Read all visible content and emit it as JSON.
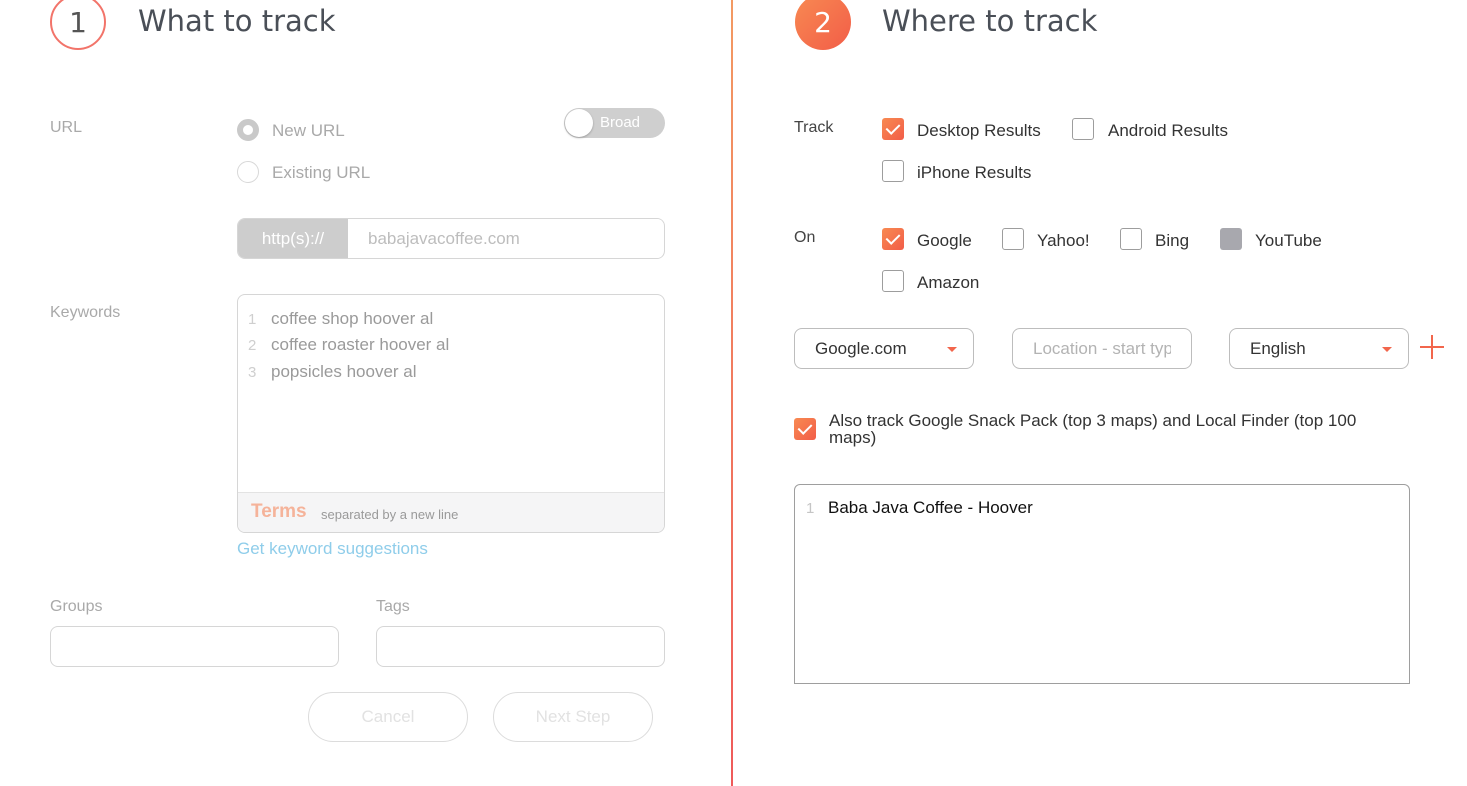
{
  "step1": {
    "number": "1",
    "title": "What to track"
  },
  "step2": {
    "number": "2",
    "title": "Where to track"
  },
  "url_section": {
    "label": "URL",
    "options": [
      "New URL",
      "Existing URL"
    ],
    "selected": "New URL",
    "toggle_label": "Broad",
    "prefix": "http(s)://",
    "placeholder": "babajavacoffee.com"
  },
  "keywords": {
    "label": "Keywords",
    "lines": [
      {
        "num": "1",
        "text": "coffee shop hoover al"
      },
      {
        "num": "2",
        "text": "coffee roaster hoover al"
      },
      {
        "num": "3",
        "text": "popsicles hoover al"
      }
    ],
    "footer_title": "Terms",
    "footer_hint": "separated by a new line",
    "suggestions_link": "Get keyword suggestions"
  },
  "groups": {
    "label": "Groups"
  },
  "tags": {
    "label": "Tags"
  },
  "buttons": {
    "cancel": "Cancel",
    "next": "Next Step"
  },
  "track": {
    "label": "Track",
    "options": [
      {
        "label": "Desktop Results",
        "state": "checked"
      },
      {
        "label": "Android Results",
        "state": "unchecked"
      },
      {
        "label": "iPhone Results",
        "state": "unchecked"
      }
    ]
  },
  "on": {
    "label": "On",
    "options": [
      {
        "label": "Google",
        "state": "checked"
      },
      {
        "label": "Yahoo!",
        "state": "unchecked"
      },
      {
        "label": "Bing",
        "state": "unchecked"
      },
      {
        "label": "YouTube",
        "state": "disabled"
      },
      {
        "label": "Amazon",
        "state": "unchecked"
      }
    ]
  },
  "search_engine": {
    "value": "Google.com"
  },
  "location": {
    "placeholder": "Location - start typ"
  },
  "language": {
    "value": "English"
  },
  "snack_pack": {
    "checked": true,
    "label": "Also track Google Snack Pack (top 3 maps) and Local Finder (top 100 maps)"
  },
  "locations_list": [
    {
      "num": "1",
      "text": "Baba Java Coffee - Hoover"
    }
  ],
  "colors": {
    "accent": "#f2664c",
    "accent_light": "#f88a52",
    "link": "#8fcdea"
  }
}
